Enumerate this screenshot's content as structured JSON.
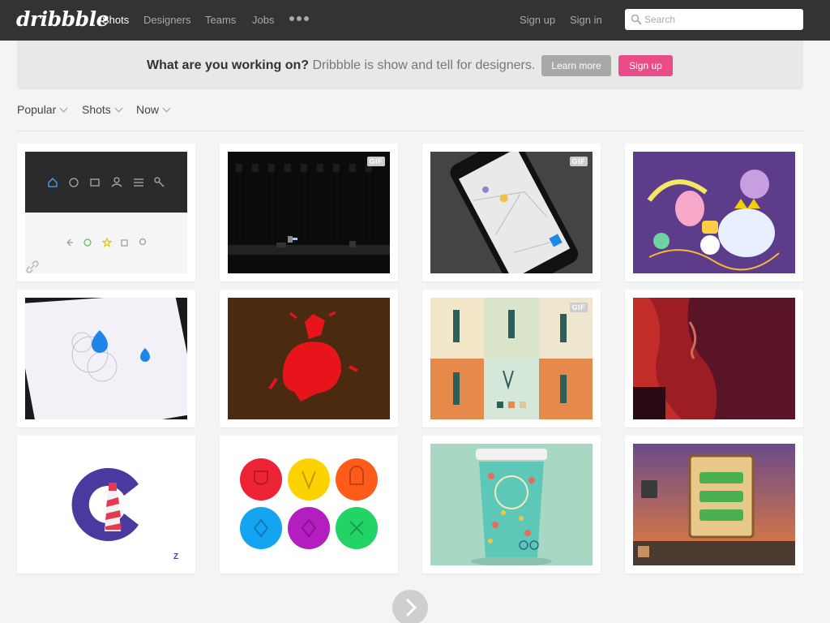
{
  "header": {
    "logo": "dribbble",
    "nav": [
      "Shots",
      "Designers",
      "Teams",
      "Jobs"
    ],
    "sign_up": "Sign up",
    "sign_in": "Sign in",
    "search_placeholder": "Search"
  },
  "banner": {
    "question": "What are you working on?",
    "tagline": " Dribbble is show and tell for designers.",
    "learn_more": "Learn more",
    "sign_up": "Sign up"
  },
  "filters": [
    "Popular",
    "Shots",
    "Now"
  ],
  "shots": [
    {
      "name": "shot-icon-bar",
      "gif": ""
    },
    {
      "name": "shot-pixel-game",
      "gif": "GIF"
    },
    {
      "name": "shot-phone-map",
      "gif": "GIF"
    },
    {
      "name": "shot-adventure-time",
      "gif": ""
    },
    {
      "name": "shot-water-drop-logo",
      "gif": ""
    },
    {
      "name": "shot-red-bull-rider",
      "gif": ""
    },
    {
      "name": "shot-wine-poster-grid",
      "gif": "GIF"
    },
    {
      "name": "shot-red-hair-girl",
      "gif": ""
    },
    {
      "name": "shot-lighthouse-logo",
      "gif": ""
    },
    {
      "name": "shot-color-badges",
      "gif": ""
    },
    {
      "name": "shot-coffee-cup",
      "gif": ""
    },
    {
      "name": "shot-game-menu",
      "gif": ""
    }
  ],
  "colors": {
    "header_bg": "#333333",
    "accent_pink": "#ea4c89",
    "button_grey": "#a8a8a8",
    "page_bg": "#f4f4f4"
  }
}
